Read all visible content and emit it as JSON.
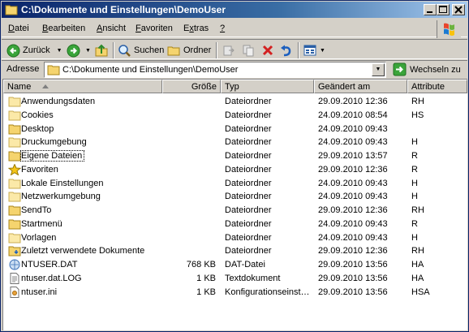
{
  "window": {
    "title": "C:\\Dokumente und Einstellungen\\DemoUser"
  },
  "menu": [
    {
      "label": "Datei",
      "key": "D",
      "rest": "atei"
    },
    {
      "label": "Bearbeiten",
      "key": "B",
      "rest": "earbeiten"
    },
    {
      "label": "Ansicht",
      "key": "A",
      "rest": "nsicht"
    },
    {
      "label": "Favoriten",
      "key": "F",
      "rest": "avoriten"
    },
    {
      "label": "Extras",
      "key": "x",
      "pre": "E",
      "rest": "tras"
    },
    {
      "label": "?",
      "key": "?",
      "rest": ""
    }
  ],
  "toolbar": {
    "back_label": "Zurück",
    "search_label": "Suchen",
    "folders_label": "Ordner"
  },
  "address": {
    "label": "Adresse",
    "value": "C:\\Dokumente und Einstellungen\\DemoUser",
    "go_label": "Wechseln zu"
  },
  "columns": {
    "name": "Name",
    "size": "Größe",
    "type": "Typ",
    "date": "Geändert am",
    "attr": "Attribute"
  },
  "files": [
    {
      "icon": "folder-icon",
      "name": "Anwendungsdaten",
      "size": "",
      "type": "Dateiordner",
      "date": "29.09.2010 12:36",
      "attr": "RH",
      "hidden": true
    },
    {
      "icon": "folder-icon",
      "name": "Cookies",
      "size": "",
      "type": "Dateiordner",
      "date": "24.09.2010 08:54",
      "attr": "HS",
      "hidden": true
    },
    {
      "icon": "folder-icon",
      "name": "Desktop",
      "size": "",
      "type": "Dateiordner",
      "date": "24.09.2010 09:43",
      "attr": "",
      "hidden": false
    },
    {
      "icon": "folder-icon",
      "name": "Druckumgebung",
      "size": "",
      "type": "Dateiordner",
      "date": "24.09.2010 09:43",
      "attr": "H",
      "hidden": true
    },
    {
      "icon": "folder-icon",
      "name": "Eigene Dateien",
      "size": "",
      "type": "Dateiordner",
      "date": "29.09.2010 13:57",
      "attr": "R",
      "hidden": false,
      "focused": true
    },
    {
      "icon": "star-icon",
      "name": "Favoriten",
      "size": "",
      "type": "Dateiordner",
      "date": "29.09.2010 12:36",
      "attr": "R",
      "hidden": false
    },
    {
      "icon": "folder-icon",
      "name": "Lokale Einstellungen",
      "size": "",
      "type": "Dateiordner",
      "date": "24.09.2010 09:43",
      "attr": "H",
      "hidden": true
    },
    {
      "icon": "folder-icon",
      "name": "Netzwerkumgebung",
      "size": "",
      "type": "Dateiordner",
      "date": "24.09.2010 09:43",
      "attr": "H",
      "hidden": true
    },
    {
      "icon": "folder-icon",
      "name": "SendTo",
      "size": "",
      "type": "Dateiordner",
      "date": "29.09.2010 12:36",
      "attr": "RH",
      "hidden": false
    },
    {
      "icon": "folder-icon",
      "name": "Startmenü",
      "size": "",
      "type": "Dateiordner",
      "date": "24.09.2010 09:43",
      "attr": "R",
      "hidden": false
    },
    {
      "icon": "folder-icon",
      "name": "Vorlagen",
      "size": "",
      "type": "Dateiordner",
      "date": "24.09.2010 09:43",
      "attr": "H",
      "hidden": true
    },
    {
      "icon": "recent-docs-icon",
      "name": "Zuletzt verwendete Dokumente",
      "size": "",
      "type": "Dateiordner",
      "date": "29.09.2010 12:36",
      "attr": "RH",
      "hidden": false
    },
    {
      "icon": "dat-file-icon",
      "name": "NTUSER.DAT",
      "size": "768 KB",
      "type": "DAT-Datei",
      "date": "29.09.2010 13:56",
      "attr": "HA",
      "hidden": false
    },
    {
      "icon": "text-file-icon",
      "name": "ntuser.dat.LOG",
      "size": "1 KB",
      "type": "Textdokument",
      "date": "29.09.2010 13:56",
      "attr": "HA",
      "hidden": false
    },
    {
      "icon": "ini-file-icon",
      "name": "ntuser.ini",
      "size": "1 KB",
      "type": "Konfigurationseinst…",
      "date": "29.09.2010 13:56",
      "attr": "HSA",
      "hidden": false
    }
  ]
}
